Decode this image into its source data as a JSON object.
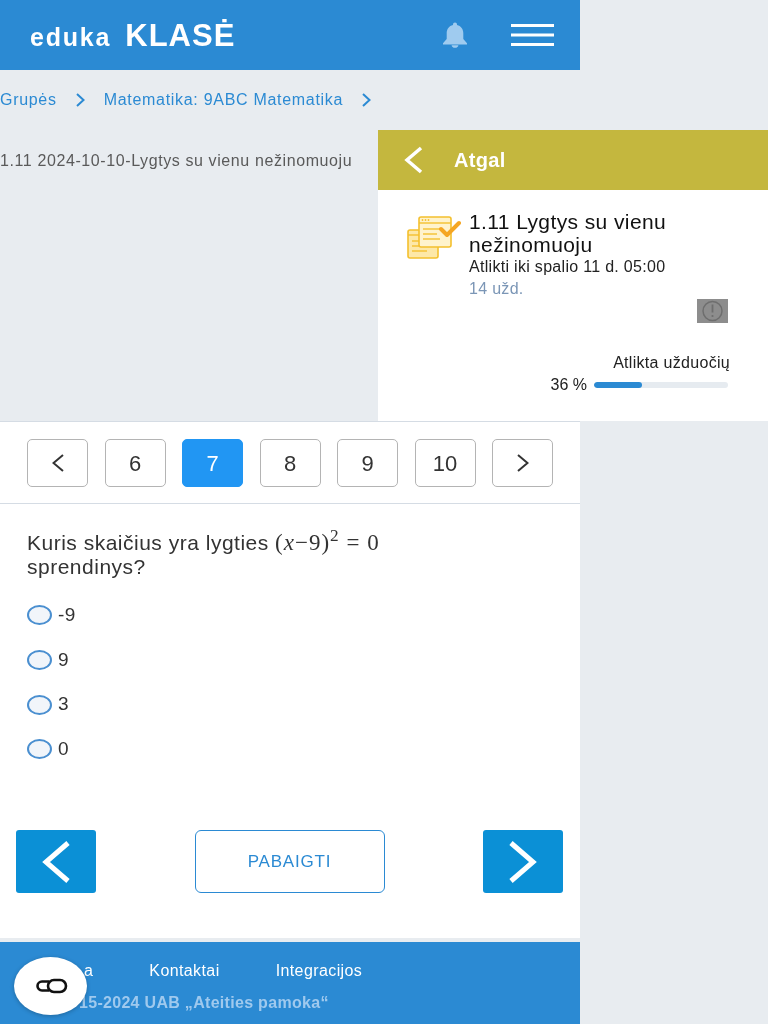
{
  "header": {
    "logo_wordmark": "eduka",
    "logo_label": "KLASĖ"
  },
  "breadcrumb": [
    {
      "label": "Grupės"
    },
    {
      "label": "Matematika: 9ABC Matematika"
    }
  ],
  "assignment_title": "1.11 2024-10-10-Lygtys su vienu nežinomuoju",
  "side_panel": {
    "back_label": "Atgal",
    "title": "1.11 Lygtys su vienu nežinomuoju",
    "deadline": "Atlikti iki spalio 11 d. 05:00",
    "task_count": "14 užd.",
    "progress_label": "Atlikta užduočių",
    "progress_text": "36 %",
    "level": 0.36
  },
  "pagination": [
    {
      "label": "6",
      "selected": false
    },
    {
      "label": "7",
      "selected": true
    },
    {
      "label": "8",
      "selected": false
    },
    {
      "label": "9",
      "selected": false
    },
    {
      "label": "10",
      "selected": false
    }
  ],
  "question": {
    "text_before": "Kuris skaičius yra lygties",
    "formula": "(*x*−9)$^{2}$ = 0",
    "text_after": "sprendinys?"
  },
  "options": [
    {
      "label": "-9",
      "selected": false
    },
    {
      "label": "9",
      "selected": false
    },
    {
      "label": "3",
      "selected": false
    },
    {
      "label": "0",
      "selected": false
    }
  ],
  "finish_button": "PABAIGTI",
  "footer": {
    "links": [
      {
        "label": "a"
      },
      {
        "label": "Kontaktai"
      },
      {
        "label": "Integracijos"
      }
    ],
    "copyright": "15-2024 UAB „Ateities pamoka“"
  }
}
